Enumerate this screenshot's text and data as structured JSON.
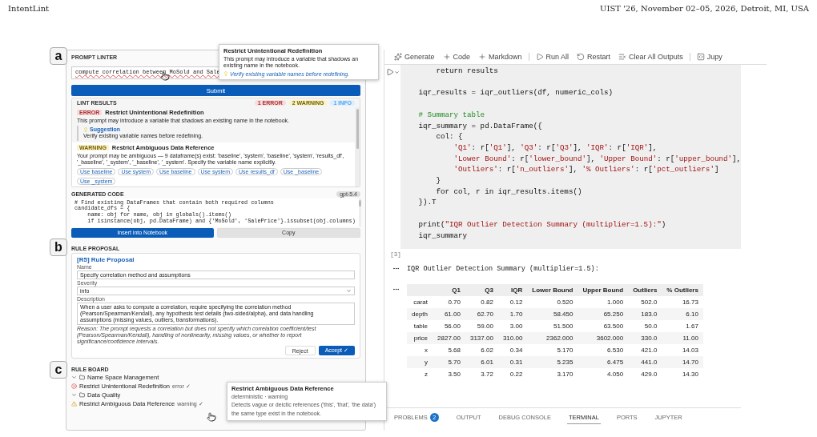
{
  "header": {
    "title": "IntentLint",
    "venue": "UIST '26, November 02–05, 2026, Detroit, MI, USA"
  },
  "linter": {
    "prompt": {
      "title": "PROMPT LINTER",
      "marker": "a",
      "value": "compute correlation between MoSold and Sale"
    },
    "tooltip": {
      "title": "Restrict Unintentional Redefinition",
      "body": "This prompt may introduce a variable that shadows an existing name in the notebook.",
      "hint": "Verify existing variable names before redefining."
    },
    "submit": "Submit",
    "lint_results": {
      "title": "LINT RESULTS",
      "counts": [
        {
          "label": "1 ERROR",
          "kind": "error"
        },
        {
          "label": "2 WARNING",
          "kind": "warning"
        },
        {
          "label": "1 INFO",
          "kind": "info"
        }
      ],
      "items": [
        {
          "kind": "error",
          "badge": "ERROR",
          "title": "Restrict Unintentional Redefinition",
          "message": "This prompt may introduce a variable that shadows an existing name in the notebook.",
          "suggestion": {
            "label": "Suggestion",
            "text": "Verify existing variable names before redefining."
          }
        },
        {
          "kind": "warning",
          "badge": "WARNING",
          "title": "Restrict Ambiguous Data Reference",
          "message": "Your prompt may be ambiguous — 9 dataframe(s) exist: 'baseline', 'system', 'baseline', 'system', 'results_df', '_baseline', '_system', '_baseline', '_system'. Specify the variable name explicitly.",
          "options": [
            "Use baseline",
            "Use system",
            "Use baseline",
            "Use system",
            "Use results_df",
            "Use _baseline",
            "Use _system"
          ]
        }
      ]
    },
    "generated_code": {
      "title": "GENERATED CODE",
      "model": "gpt-5.4",
      "lines": [
        "# Find existing DataFrames that contain both required columns",
        "candidate_dfs = {",
        "    name: obj for name, obj in globals().items()",
        "    if isinstance(obj, pd.DataFrame) and {'MoSold', 'SalePrice'}.issubset(obj.columns)"
      ],
      "buttons": [
        {
          "label": "Insert into Notebook",
          "kind": "primary"
        },
        {
          "label": "Copy",
          "kind": "secondary"
        }
      ]
    },
    "rule_proposal": {
      "title": "RULE PROPOSAL",
      "marker": "b",
      "heading": "[R5] Rule Proposal",
      "fields": [
        {
          "label": "Name",
          "kind": "text",
          "value": "Specify correlation method and assumptions"
        },
        {
          "label": "Severity",
          "kind": "select",
          "value": "info"
        },
        {
          "label": "Description",
          "kind": "textarea",
          "value": "When a user asks to compute a correlation, require specifying the correlation method (Pearson/Spearman/Kendall), any hypothesis test details (two-sided/alpha), and data handling assumptions (missing values, outliers, transformations)."
        }
      ],
      "reason": "Reason: The prompt requests a correlation but does not specify which correlation coefficient/test (Pearson/Spearman/Kendall), handling of nonlinearity, missing values, or whether to report significance/confidence intervals.",
      "buttons": [
        {
          "label": "Reject",
          "kind": "secondary"
        },
        {
          "label": "Accept ✓",
          "kind": "primary"
        }
      ]
    },
    "rule_board": {
      "title": "RULE BOARD",
      "marker": "c",
      "groups": [
        {
          "label": "Name Space Management",
          "expanded": true,
          "children": [
            {
              "label": "Restrict Unintentional Redefinition",
              "kind": "error",
              "status": "error ✓"
            }
          ]
        },
        {
          "label": "Data Quality",
          "expanded": true,
          "children": [
            {
              "label": "Restrict Ambiguous Data Reference",
              "kind": "warning",
              "status": "warning ✓"
            }
          ]
        }
      ],
      "tooltip": {
        "title": "Restrict Ambiguous Data Reference",
        "meta": "deterministic · warning",
        "lines": [
          "Detects vague or deictic references ('this', 'that', 'the data')",
          "the same type exist in the notebook."
        ]
      }
    }
  },
  "notebook": {
    "toolbar": [
      {
        "items": [
          {
            "label": "Generate",
            "kind": "generate"
          },
          {
            "label": "Code",
            "kind": "add"
          },
          {
            "label": "Markdown",
            "kind": "add"
          }
        ]
      },
      {
        "items": [
          {
            "label": "Run All",
            "kind": "run"
          },
          {
            "label": "Restart",
            "kind": "restart"
          },
          {
            "label": "Clear All Outputs",
            "kind": "clear"
          }
        ]
      },
      {
        "items": [
          {
            "label": "Jupy",
            "kind": "kernel"
          }
        ]
      }
    ],
    "cell": {
      "exec_count": "[3]",
      "blocks": [
        [
          "        return results"
        ],
        [
          "    iqr_results = iqr_outliers(df, numeric_cols)"
        ],
        [
          "    # Summary table",
          "    iqr_summary = pd.DataFrame({",
          "        col: {",
          "            'Q1': r['Q1'], 'Q3': r['Q3'], 'IQR': r['IQR'],",
          "            'Lower Bound': r['lower_bound'], 'Upper Bound': r['upper_bound'],",
          "            'Outliers': r['n_outliers'], '% Outliers': r['pct_outliers']",
          "        }",
          "        for col, r in iqr_results.items()",
          "    }).T"
        ],
        [
          "    print(\"IQR Outlier Detection Summary (multiplier=1.5):\")",
          "    iqr_summary"
        ]
      ]
    },
    "output": {
      "text": "IQR Outlier Detection Summary (multiplier=1.5):",
      "table": {
        "columns": [
          "Q1",
          "Q3",
          "IQR",
          "Lower Bound",
          "Upper Bound",
          "Outliers",
          "% Outliers"
        ],
        "rows": [
          {
            "label": "carat",
            "cells": [
              "0.70",
              "0.82",
              "0.12",
              "0.520",
              "1.000",
              "502.0",
              "16.73"
            ]
          },
          {
            "label": "depth",
            "cells": [
              "61.00",
              "62.70",
              "1.70",
              "58.450",
              "65.250",
              "183.0",
              "6.10"
            ]
          },
          {
            "label": "table",
            "cells": [
              "56.00",
              "59.00",
              "3.00",
              "51.500",
              "63.500",
              "50.0",
              "1.67"
            ]
          },
          {
            "label": "price",
            "cells": [
              "2827.00",
              "3137.00",
              "310.00",
              "2362.000",
              "3602.000",
              "330.0",
              "11.00"
            ]
          },
          {
            "label": "x",
            "cells": [
              "5.68",
              "6.02",
              "0.34",
              "5.170",
              "6.530",
              "421.0",
              "14.03"
            ]
          },
          {
            "label": "y",
            "cells": [
              "5.70",
              "6.01",
              "0.31",
              "5.235",
              "6.475",
              "441.0",
              "14.70"
            ]
          },
          {
            "label": "z",
            "cells": [
              "3.50",
              "3.72",
              "0.22",
              "3.170",
              "4.050",
              "429.0",
              "14.30"
            ]
          }
        ]
      }
    },
    "panel_tabs": [
      {
        "label": "PROBLEMS",
        "badge": "2",
        "selected": false
      },
      {
        "label": "OUTPUT",
        "selected": false
      },
      {
        "label": "DEBUG CONSOLE",
        "selected": false
      },
      {
        "label": "TERMINAL",
        "selected": true
      },
      {
        "label": "PORTS",
        "selected": false
      },
      {
        "label": "JUPYTER",
        "selected": false
      }
    ]
  }
}
